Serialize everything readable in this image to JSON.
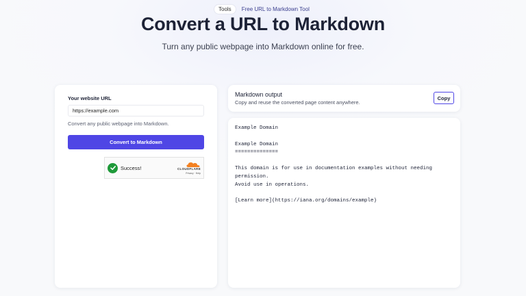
{
  "badge": {
    "tag": "Tools",
    "text": "Free URL to Markdown Tool"
  },
  "hero": {
    "title": "Convert a URL to Markdown",
    "subtitle": "Turn any public webpage into Markdown online for free."
  },
  "form": {
    "label": "Your website URL",
    "url_value": "https://example.com",
    "helper": "Convert any public webpage into Markdown.",
    "submit_label": "Convert to Markdown"
  },
  "captcha": {
    "status": "Success!",
    "brand": "CLOUDFLARE",
    "links": "Privacy · Help",
    "check_color": "#1f9a3a",
    "brand_color": "#f38020"
  },
  "output": {
    "title": "Markdown output",
    "description": "Copy and reuse the converted page content anywhere.",
    "copy_label": "Copy",
    "content": "Example Domain\n\nExample Domain\n==============\n\nThis domain is for use in documentation examples without needing permission.\nAvoid use in operations.\n\n[Learn more](https://iana.org/domains/example)"
  },
  "colors": {
    "accent": "#4f46e5"
  }
}
